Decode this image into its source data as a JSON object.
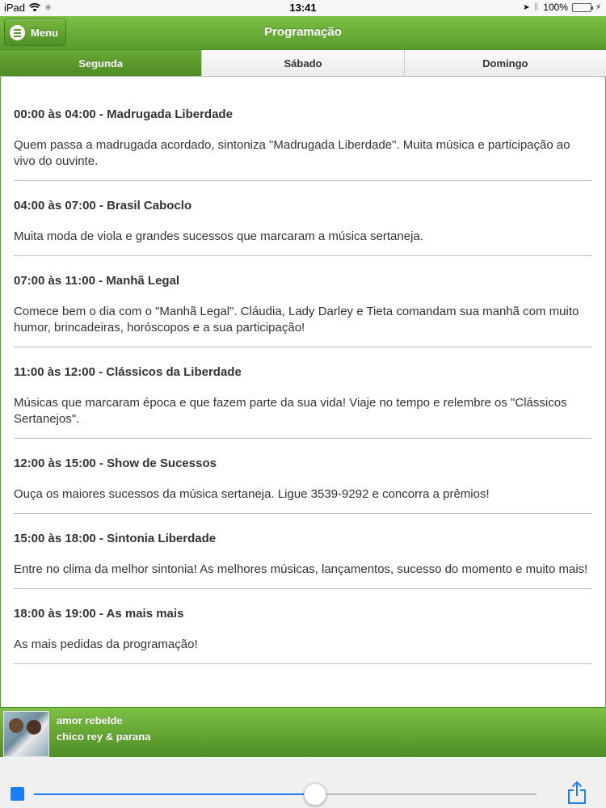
{
  "status_bar": {
    "device": "iPad",
    "time": "13:41",
    "battery": "100%"
  },
  "header": {
    "menu_label": "Menu",
    "title": "Programação"
  },
  "tabs": [
    {
      "label": "Segunda",
      "active": true
    },
    {
      "label": "Sábado",
      "active": false
    },
    {
      "label": "Domingo",
      "active": false
    }
  ],
  "programs": [
    {
      "title": "00:00 às 04:00 - Madrugada Liberdade",
      "desc": "Quem passa a madrugada acordado, sintoniza \"Madrugada Liberdade\". Muita música e participação ao vivo do ouvinte."
    },
    {
      "title": "04:00 às 07:00 - Brasil Caboclo",
      "desc": "Muita moda de viola e grandes sucessos que marcaram a música sertaneja."
    },
    {
      "title": "07:00 às 11:00 - Manhã Legal",
      "desc": "Comece bem o dia com o \"Manhã Legal\". Cláudia, Lady Darley e Tieta comandam sua manhã com muito humor, brincadeiras, horóscopos e a sua participação!"
    },
    {
      "title": "11:00 às 12:00 - Clássicos da Liberdade",
      "desc": "Músicas que marcaram época e que fazem parte da sua vida!  Viaje no tempo e relembre os \"Clássicos Sertanejos\"."
    },
    {
      "title": "12:00 às 15:00 - Show de Sucessos",
      "desc": "Ouça os maiores sucessos da música sertaneja. Ligue 3539-9292 e concorra a prêmios!"
    },
    {
      "title": "15:00 às 18:00 - Sintonia Liberdade",
      "desc": "Entre no clima da melhor sintonia! As melhores músicas, lançamentos, sucesso do momento e muito mais!"
    },
    {
      "title": "18:00 às 19:00 - As mais mais",
      "desc": "As mais pedidas da programação!"
    }
  ],
  "player": {
    "song_title": "amor rebelde",
    "artist": "chico rey & parana",
    "volume_fraction": 0.56
  },
  "colors": {
    "brand_green": "#5a9a2e",
    "accent_blue": "#1a7ef5"
  }
}
